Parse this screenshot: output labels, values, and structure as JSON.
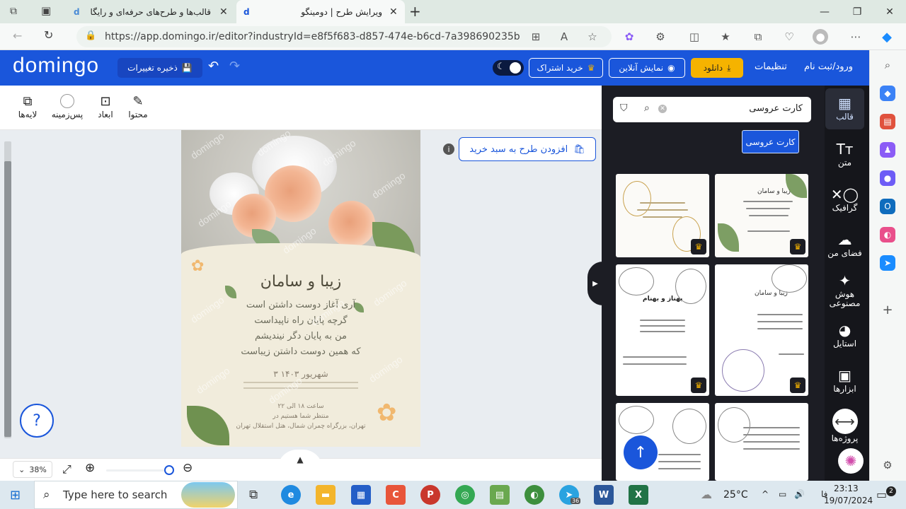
{
  "browser": {
    "tabs": [
      {
        "title": "قالب‌ها و طرح‌های حرفه‌ای و رایگان",
        "active": false
      },
      {
        "title": "ویرایش طرح | دومینگو",
        "active": true
      }
    ],
    "new_tab": "+",
    "url": "https://app.domingo.ir/editor?industryId=e8f5f683-d857-474e-b6cd-7a398690235b"
  },
  "header": {
    "logo": "domingo",
    "save_label": "ذخیره تغییرات",
    "subscribe_label": "خرید اشتراک",
    "preview_label": "نمایش آنلاین",
    "download_label": "دانلود",
    "settings_label": "تنظیمات",
    "login_label": "ورود/ثبت نام"
  },
  "toolbar": {
    "content": "محتوا",
    "dimensions": "ابعاد",
    "background": "پس‌زمینه",
    "layers": "لایه‌ها"
  },
  "canvas": {
    "add_to_cart": "افزودن طرح به سبد خرید",
    "info": "i",
    "help": "?",
    "watermark": "domingo",
    "invitation": {
      "names": "زیبا و سامان",
      "poem": [
        "آری آغاز دوست داشتن است",
        "گرچه پایان راه ناپیداست",
        "من به پایان دگر نیندیشم",
        "که همین دوست داشتن زیباست"
      ],
      "date": "۳ شهریور ۱۴۰۳",
      "details": [
        "ساعت ۱۸ الی ۲۲",
        "منتظر شما هستیم در",
        "تهران، بزرگراه چمران شمال، هتل استقلال تهران"
      ]
    }
  },
  "zoom": {
    "level": "38%",
    "slider_fraction": 0.95
  },
  "panel": {
    "search_value": "کارت عروسی",
    "tag_chip": "کارت عروسی",
    "collapse_arrow": "▶",
    "scroll_top": "↑",
    "thumbnails": [
      {
        "heading": "",
        "premium": true
      },
      {
        "heading": "زیبا و سامان",
        "premium": true
      },
      {
        "heading": "بهناز و بهنام",
        "premium": true
      },
      {
        "heading": "زیبا و سامان",
        "premium": true
      },
      {
        "heading": "",
        "premium": false
      },
      {
        "heading": "",
        "premium": false
      }
    ]
  },
  "rail": {
    "template": "قالب",
    "text": "متن",
    "graphic": "گرافیک",
    "myspace": "فضای من",
    "ai": "هوش مصنوعی",
    "style": "استایل",
    "tools": "ابزارها",
    "projects": "پروژه‌ها"
  },
  "taskbar": {
    "search_placeholder": "Type here to search",
    "weather": "25°C",
    "lang": "فا",
    "time": "23:13",
    "date": "19/07/2024",
    "notif_count": "2",
    "telegram_badge": "36"
  },
  "colors": {
    "brand": "#1a56db",
    "panel_bg": "#1c1d24",
    "download": "#f5b300"
  }
}
